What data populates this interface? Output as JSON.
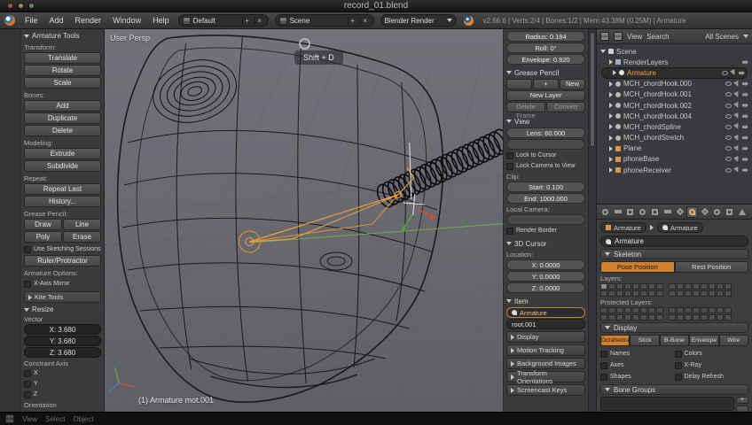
{
  "colors": {
    "accent": "#e08e2b",
    "header_orange": "#cf7f2e",
    "selected_text": "#f5a24a",
    "viewport_bg": "#6e6e74"
  },
  "titlebar": {
    "title": "record_01.blend"
  },
  "menubar": {
    "menus": [
      "File",
      "Add",
      "Render",
      "Window",
      "Help"
    ],
    "layout": "Default",
    "scene": "Scene",
    "engine": "Blender Render",
    "plus": "+",
    "close": "×",
    "stats": "v2.66.6 | Verts:2/4 | Bones:1/2 | Mem:43.38M (0.25M) | Armature"
  },
  "toolshelf": {
    "title": "Armature Tools",
    "sections": [
      {
        "label": "Transform:",
        "buttons": [
          "Translate",
          "Rotate",
          "Scale"
        ]
      },
      {
        "label": "Bones:",
        "buttons": [
          "Add",
          "Duplicate",
          "Delete"
        ]
      },
      {
        "label": "Modeling:",
        "buttons": [
          "Extrude",
          "Subdivide"
        ]
      },
      {
        "label": "Repeat:",
        "buttons": [
          "Repeat Last",
          "History..."
        ]
      }
    ],
    "grease": {
      "label": "Grease Pencil:",
      "draw": "Draw",
      "line": "Line",
      "poly": "Poly",
      "erase": "Erase",
      "sketch": "Use Sketching Sessions",
      "ruler": "Ruler/Protractor"
    },
    "options_label": "Armature Options:",
    "mirror": "X-Axis Mirror",
    "kite": "Kite Tools"
  },
  "operator": {
    "title": "Resize",
    "vector_label": "Vector",
    "x": "X: 3.680",
    "y": "Y: 3.680",
    "z": "Z: 3.680",
    "constraint_label": "Constraint Axis",
    "ax": "X",
    "ay": "Y",
    "az": "Z",
    "orientation_label": "Orientation"
  },
  "viewport": {
    "view_label": "User Persp",
    "object_label": "(1) Armature mot.001",
    "screencast_key": "Shift + D"
  },
  "npanel": {
    "radius": "Radius: 0.184",
    "roll": "Roll: 0°",
    "envelope": "Envelope: 0.920",
    "grease": {
      "header": "Grease Pencil",
      "plus": "+",
      "new_btn": "New",
      "new_layer": "New Layer",
      "delete_frame": "Delete Frame",
      "convert": "Convert"
    },
    "view": {
      "header": "View",
      "lens": "Lens: 60.000",
      "lock_cursor": "Lock to Cursor",
      "lock_camera": "Lock Camera to View",
      "clip": "Clip:",
      "start": "Start: 0.100",
      "end": "End: 1000.000",
      "local": "Local Camera:",
      "render_border": "Render Border"
    },
    "cursor": {
      "header": "3D Cursor",
      "location": "Location:",
      "x": "X: 0.0000",
      "y": "Y: 0.0000",
      "z": "Z: 0.0000"
    },
    "item": {
      "header": "Item",
      "object": "Armature",
      "bone": "root.001"
    },
    "collapsed": [
      "Display",
      "Motion Tracking",
      "Background Images",
      "Transform Orientations",
      "Screencast Keys"
    ]
  },
  "outliner": {
    "view": "View",
    "search": "Search",
    "filter": "All Scenes",
    "items": [
      "Scene",
      "RenderLayers",
      "Armature",
      "MCH_chordHook.000",
      "MCH_chordHook.001",
      "MCH_chordHook.002",
      "MCH_chordHook.004",
      "MCH_chordSpline",
      "MCH_chordStretch",
      "Plane",
      "phoneBase",
      "phoneReceiver"
    ]
  },
  "properties": {
    "object": "Armature",
    "data": "Armature",
    "name": "Armature",
    "skeleton": {
      "header": "Skeleton",
      "pose": "Pose Position",
      "rest": "Rest Position",
      "layers": "Layers:",
      "protected": "Protected Layers:"
    },
    "display": {
      "header": "Display",
      "modes": [
        "Octahedral",
        "Stick",
        "B-Bone",
        "Envelope",
        "Wire"
      ],
      "c1": "Names",
      "c2": "Axes",
      "c3": "Shapes",
      "c4": "Colors",
      "c5": "X-Ray",
      "c6": "Delay Refresh"
    },
    "groups": "Bone Groups"
  },
  "viewheader": {
    "m1": "View",
    "m2": "Select",
    "m3": "Object"
  }
}
